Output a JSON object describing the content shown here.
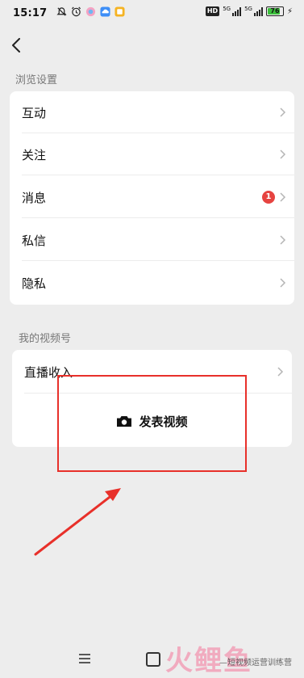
{
  "status_bar": {
    "time": "15:17",
    "hd": "HD",
    "signal_label_1": "5G",
    "signal_label_2": "5G",
    "battery": "76"
  },
  "sections": {
    "browse_title": "浏览设置",
    "channel_title": "我的视频号"
  },
  "browse_items": [
    {
      "label": "互动"
    },
    {
      "label": "关注"
    },
    {
      "label": "消息",
      "badge": "1"
    },
    {
      "label": "私信"
    },
    {
      "label": "隐私"
    }
  ],
  "channel": {
    "income_label": "直播收入",
    "publish_label": "发表视频"
  },
  "watermark": {
    "logo": "火鲤鱼",
    "text": "—短视频运营训练营"
  },
  "colors": {
    "background": "#ededed",
    "card": "#ffffff",
    "badge": "#e64340",
    "annotation": "#e8302a",
    "battery": "#3bbf3b"
  }
}
